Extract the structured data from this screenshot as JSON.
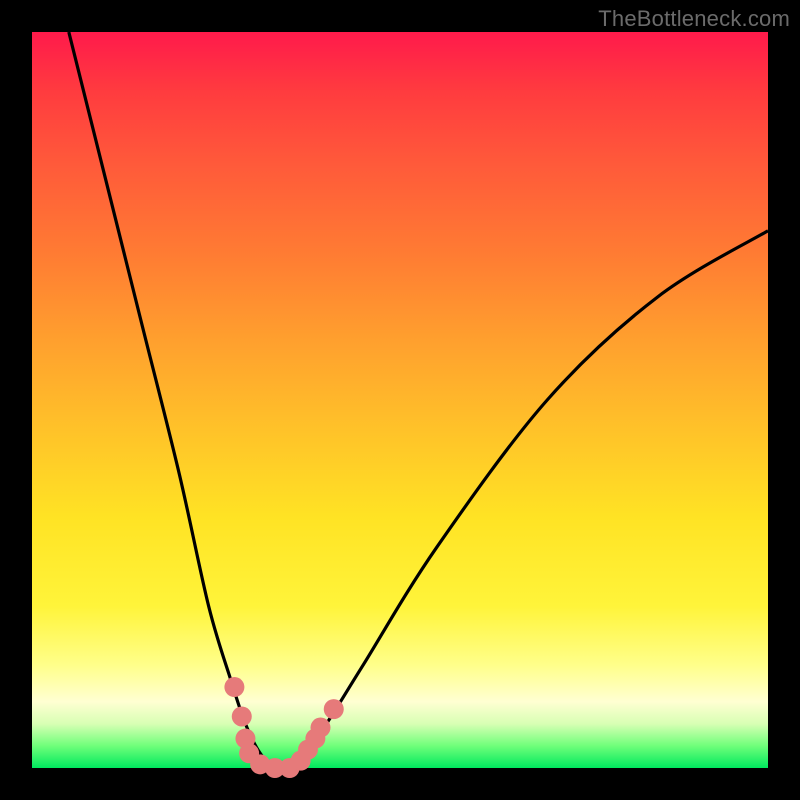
{
  "watermark": "TheBottleneck.com",
  "chart_data": {
    "type": "line",
    "title": "",
    "xlabel": "",
    "ylabel": "",
    "xlim": [
      0,
      100
    ],
    "ylim": [
      0,
      100
    ],
    "series": [
      {
        "name": "bottleneck-curve",
        "x": [
          5,
          10,
          15,
          20,
          24,
          27,
          29,
          31,
          33,
          35,
          37,
          40,
          45,
          55,
          70,
          85,
          100
        ],
        "values": [
          100,
          80,
          60,
          40,
          22,
          12,
          6,
          2,
          0,
          0,
          2,
          6,
          14,
          30,
          50,
          64,
          73
        ]
      }
    ],
    "markers": {
      "name": "highlight-dots",
      "color": "#e67a7a",
      "points": [
        {
          "x": 27.5,
          "y": 11
        },
        {
          "x": 28.5,
          "y": 7
        },
        {
          "x": 29.0,
          "y": 4
        },
        {
          "x": 29.5,
          "y": 2
        },
        {
          "x": 31.0,
          "y": 0.5
        },
        {
          "x": 33.0,
          "y": 0
        },
        {
          "x": 35.0,
          "y": 0
        },
        {
          "x": 36.5,
          "y": 1
        },
        {
          "x": 37.5,
          "y": 2.5
        },
        {
          "x": 38.5,
          "y": 4
        },
        {
          "x": 39.2,
          "y": 5.5
        },
        {
          "x": 41.0,
          "y": 8
        }
      ]
    },
    "gradient_stops": [
      {
        "pos": 0,
        "color": "#ff1a4b"
      },
      {
        "pos": 50,
        "color": "#ffcc22"
      },
      {
        "pos": 90,
        "color": "#ffffb0"
      },
      {
        "pos": 100,
        "color": "#00e85e"
      }
    ]
  }
}
